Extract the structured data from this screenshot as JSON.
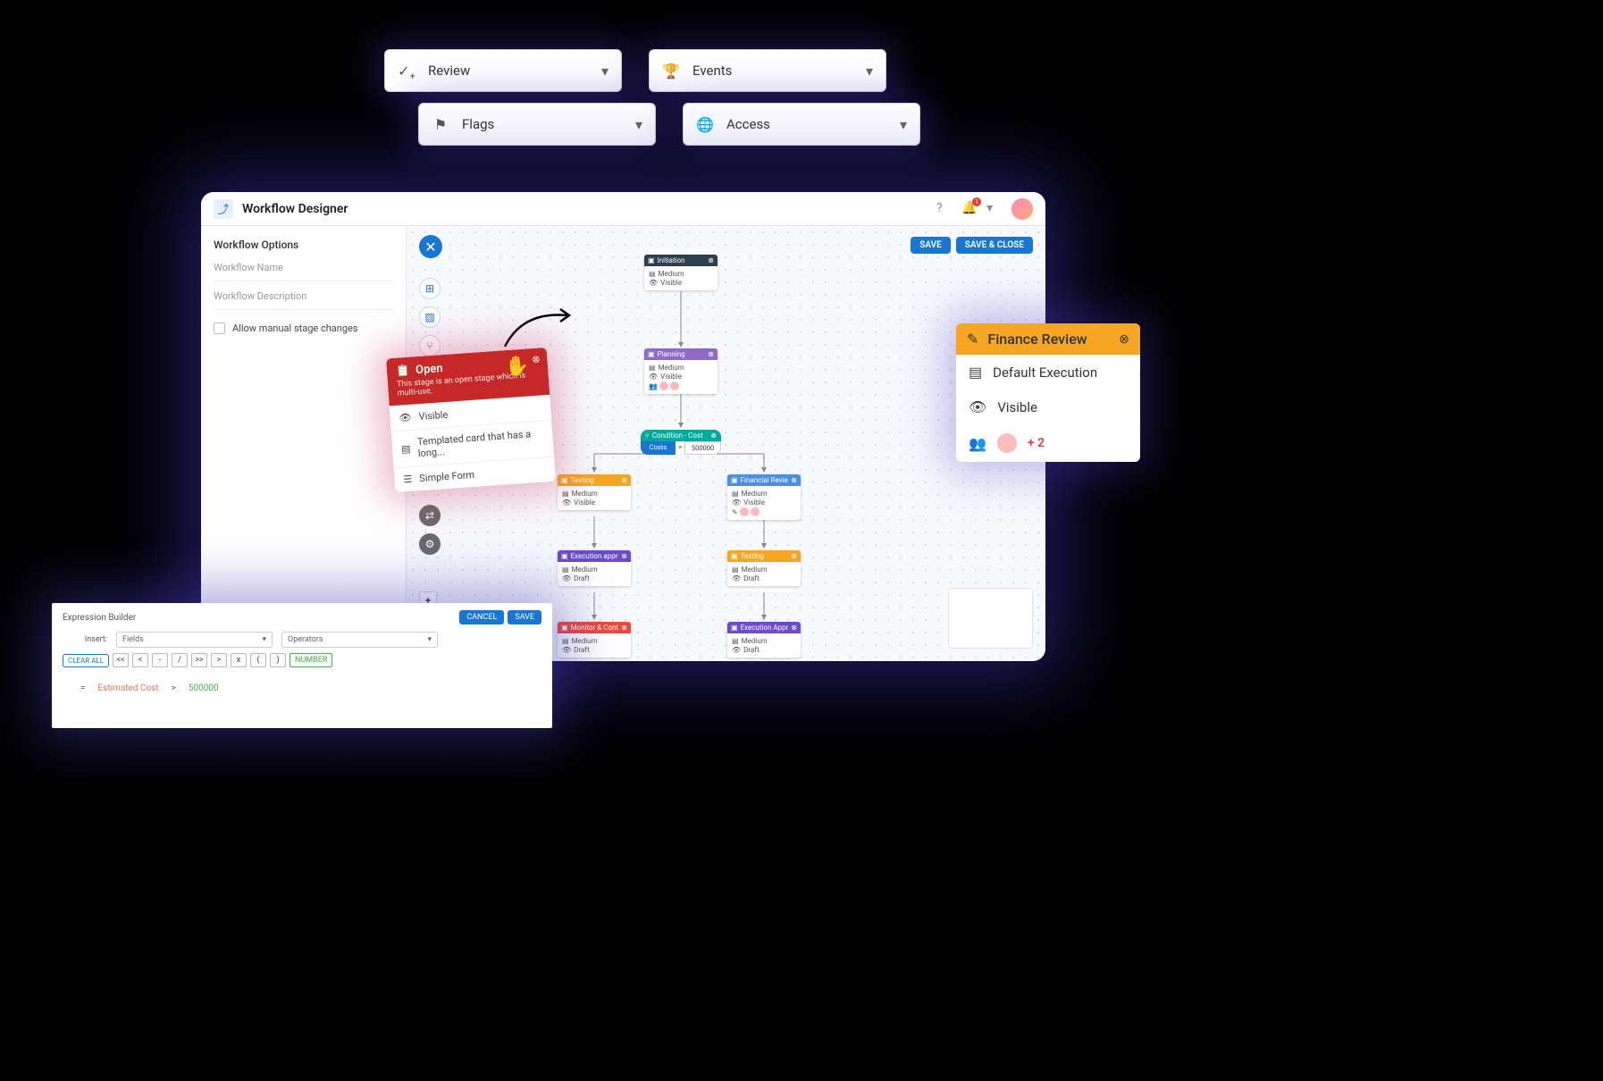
{
  "dropdowns": {
    "review": "Review",
    "events": "Events",
    "flags": "Flags",
    "access": "Access"
  },
  "app": {
    "title": "Workflow Designer",
    "notif_count": "1",
    "save": "SAVE",
    "save_close": "SAVE & CLOSE"
  },
  "sidebar": {
    "section": "Workflow Options",
    "name_label": "Workflow Name",
    "desc_label": "Workflow Description",
    "checkbox": "Allow manual stage changes"
  },
  "nodes": {
    "initiation": {
      "title": "Initiation",
      "pri": "Medium",
      "vis": "Visible"
    },
    "planning": {
      "title": "Planning",
      "pri": "Medium",
      "vis": "Visible"
    },
    "condition": {
      "title": "Condition - Cost",
      "left": "Costs",
      "right": "500000"
    },
    "testing1": {
      "title": "Testing",
      "pri": "Medium",
      "vis": "Visible"
    },
    "financial_review": {
      "title": "Financial Review",
      "pri": "Medium",
      "vis": "Visible"
    },
    "exec_approval1": {
      "title": "Execution approval",
      "pri": "Medium",
      "vis": "Draft"
    },
    "testing2": {
      "title": "Testing",
      "pri": "Medium",
      "vis": "Draft"
    },
    "monitor": {
      "title": "Monitor & Control",
      "pri": "Medium",
      "vis": "Draft"
    },
    "exec_approval2": {
      "title": "Execution Approval",
      "pri": "Medium",
      "vis": "Draft"
    }
  },
  "open_card": {
    "title": "Open",
    "subtitle": "This stage is an open stage which is multi-use.",
    "rows": {
      "visible": "Visible",
      "templated": "Templated card that has a long...",
      "simple": "Simple Form"
    }
  },
  "finance_popup": {
    "title": "Finance Review",
    "rows": {
      "exec": "Default Execution",
      "vis": "Visible",
      "plus": "+ 2"
    }
  },
  "expr": {
    "title": "Expression Builder",
    "cancel": "CANCEL",
    "save": "SAVE",
    "insert_label": "Insert:",
    "fields": "Fields",
    "operators": "Operators",
    "clear": "CLEAR ALL",
    "ops": [
      "<<",
      "<",
      "-",
      "/",
      ">>",
      ">",
      "x",
      "(",
      ")"
    ],
    "number": "NUMBER",
    "formula": {
      "eq": "=",
      "var": "Estimated Cost",
      "op": ">",
      "num": "500000"
    }
  }
}
